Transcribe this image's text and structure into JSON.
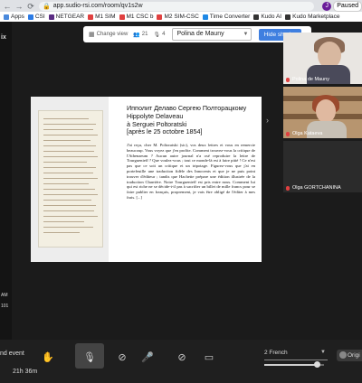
{
  "browser": {
    "back_label": "←",
    "forward_label": "→",
    "reload_label": "⟳",
    "url": "app.sudio-rsi.com/room/qv1s2w",
    "avatar_letter": "J",
    "paused_label": "Paused"
  },
  "bookmarks": [
    {
      "label": "Apps",
      "color": "#4a89dc"
    },
    {
      "label": "CSI",
      "color": "#2c7be5"
    },
    {
      "label": "NETGEAR",
      "color": "#5b2c83"
    },
    {
      "label": "M1 SIM",
      "color": "#e04040"
    },
    {
      "label": "M1 CSC b",
      "color": "#e04040"
    },
    {
      "label": "M2 SIM-CSC",
      "color": "#e04040"
    },
    {
      "label": "Time Converter",
      "color": "#1e88e5"
    },
    {
      "label": "Kudo AI",
      "color": "#333333"
    },
    {
      "label": "Kudo Marketplace",
      "color": "#333333"
    }
  ],
  "sidebar": {
    "title_fragment": "ix",
    "time_fragment": "AM",
    "date_fragment": "101"
  },
  "toolbar": {
    "change_view_label": "Change view",
    "participants_count": "21",
    "speakers_count": "4",
    "selected_speaker": "Polina de Mauny",
    "hide_sharing_label": "Hide sharing"
  },
  "document": {
    "title_lines": [
      "Ипполит Делаво Сергею Полторацкому",
      "Hippolyte Delaveau",
      "à Serguei Poltoratski",
      "[après le 25 octobre 1854]"
    ],
    "body": "J'ai reçu, cher M. Poltoratski (sic), vos deux lettres et vous en remercie beaucoup. Vous voyez que j'en profite. Comment trouvez-vous la critique de l'Athenaeum ? Aucun autre journal n'a osé reproduire la lettre de Tourguenieff ? Que voulez-vous ; tout ce monde-là est à faire pitié ! Ce n'est pas que ce soit un critique et un tripotage. Figurez-vous que j'ai en portefeuille une traduction fidèle des Innocents et que je ne puis point trouver d'éditeur ; tandis que Hachette prépare une édition illustrée de la traduction Charrière. Notre Tourguenieff est pris entre nous. Comment lui qui est riche ne se décide-t-il pas à sacrifier un billet de mille francs pour se faire publier en français, proprement, je vais être obligé de l'éditer à mes frais. [...]"
  },
  "participants": [
    {
      "name": "Polina de Mauny"
    },
    {
      "name": "Olga Kataeva"
    },
    {
      "name": "Olga GORTCHANINA"
    }
  ],
  "bottom": {
    "left_label": "nd event",
    "time_label": "21h 36m",
    "language_selected": "2 French",
    "volume_fraction": 0.88,
    "original_label": "Origi"
  }
}
